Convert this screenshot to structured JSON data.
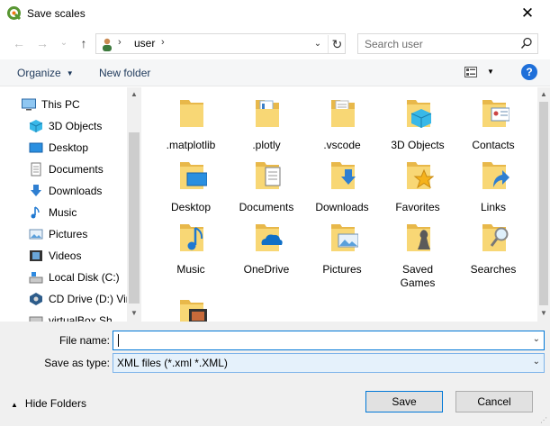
{
  "window": {
    "title": "Save scales",
    "close_glyph": "✕"
  },
  "address": {
    "crumb": "user",
    "sep": "›"
  },
  "search": {
    "placeholder": "Search user"
  },
  "toolbar": {
    "organize": "Organize",
    "new_folder": "New folder",
    "help_glyph": "?"
  },
  "nav_pane": {
    "items": [
      {
        "label": "This PC",
        "icon": "this-pc-icon"
      },
      {
        "label": "3D Objects",
        "icon": "3d-objects-icon"
      },
      {
        "label": "Desktop",
        "icon": "desktop-icon"
      },
      {
        "label": "Documents",
        "icon": "documents-icon"
      },
      {
        "label": "Downloads",
        "icon": "downloads-icon"
      },
      {
        "label": "Music",
        "icon": "music-icon"
      },
      {
        "label": "Pictures",
        "icon": "pictures-icon"
      },
      {
        "label": "Videos",
        "icon": "videos-icon"
      },
      {
        "label": "Local Disk (C:)",
        "icon": "local-disk-icon"
      },
      {
        "label": "CD Drive (D:) Vir",
        "icon": "cd-drive-icon"
      },
      {
        "label": "virtualBox Sh",
        "icon": "network-drive-icon"
      }
    ]
  },
  "folders": [
    {
      "label": ".matplotlib",
      "icon": "folder-icon"
    },
    {
      "label": ".plotly",
      "icon": "folder-documents-icon"
    },
    {
      "label": ".vscode",
      "icon": "folder-documents-icon"
    },
    {
      "label": "3D Objects",
      "icon": "3d-objects-folder-icon"
    },
    {
      "label": "Contacts",
      "icon": "contacts-folder-icon"
    },
    {
      "label": "Desktop",
      "icon": "desktop-folder-icon"
    },
    {
      "label": "Documents",
      "icon": "documents-folder-icon"
    },
    {
      "label": "Downloads",
      "icon": "downloads-folder-icon"
    },
    {
      "label": "Favorites",
      "icon": "favorites-folder-icon"
    },
    {
      "label": "Links",
      "icon": "links-folder-icon"
    },
    {
      "label": "Music",
      "icon": "music-folder-icon"
    },
    {
      "label": "OneDrive",
      "icon": "onedrive-folder-icon"
    },
    {
      "label": "Pictures",
      "icon": "pictures-folder-icon"
    },
    {
      "label": "Saved Games",
      "icon": "saved-games-folder-icon"
    },
    {
      "label": "Searches",
      "icon": "searches-folder-icon"
    },
    {
      "label": "",
      "icon": "videos-folder-icon"
    }
  ],
  "form": {
    "file_name_label": "File name:",
    "file_name_value": "",
    "save_as_label": "Save as type:",
    "save_as_value": "XML files (*.xml *.XML)"
  },
  "footer": {
    "hide_folders": "Hide Folders",
    "save": "Save",
    "cancel": "Cancel"
  },
  "colors": {
    "accent": "#0078d7",
    "folder": "#f8d775",
    "help": "#1e6fd9"
  }
}
